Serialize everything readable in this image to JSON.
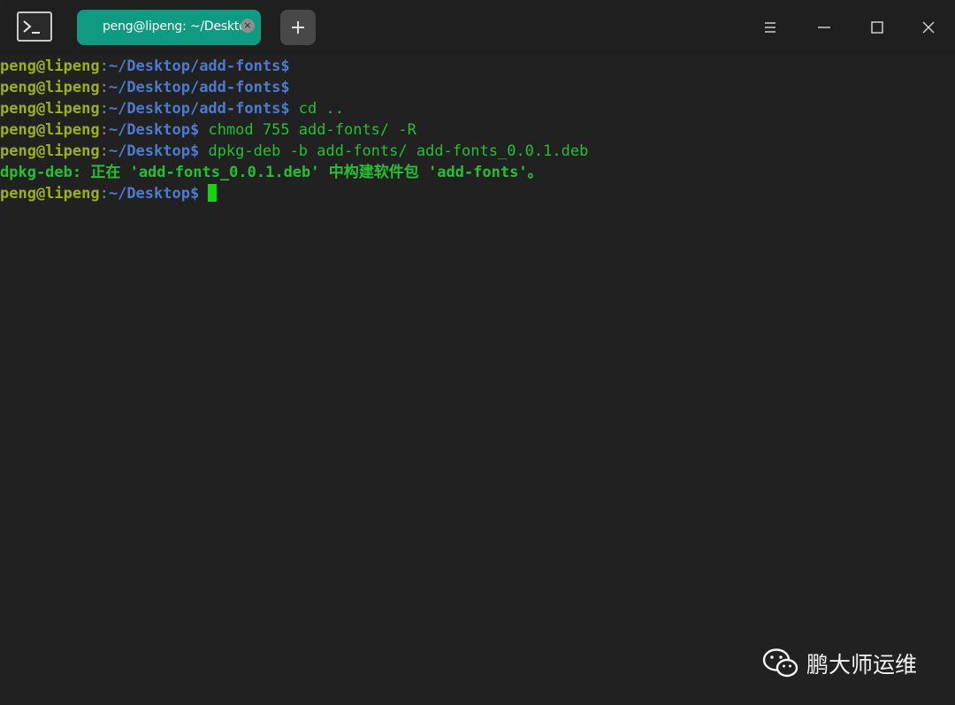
{
  "tab": {
    "title": "peng@lipeng: ~/Desktop",
    "close_glyph": "×"
  },
  "icons": {
    "app": "terminal-icon",
    "new_tab": "plus-icon",
    "menu": "hamburger-menu-icon",
    "minimize": "minimize-icon",
    "maximize": "maximize-icon",
    "close": "close-icon",
    "watermark": "wechat-icon"
  },
  "terminal": {
    "lines": [
      {
        "user": "peng@lipeng",
        "sep": ":",
        "path": "~/Desktop/add-fonts",
        "prompt": "$",
        "command": ""
      },
      {
        "user": "peng@lipeng",
        "sep": ":",
        "path": "~/Desktop/add-fonts",
        "prompt": "$",
        "command": ""
      },
      {
        "user": "peng@lipeng",
        "sep": ":",
        "path": "~/Desktop/add-fonts",
        "prompt": "$",
        "command": " cd .."
      },
      {
        "user": "peng@lipeng",
        "sep": ":",
        "path": "~/Desktop",
        "prompt": "$",
        "command": " chmod 755 add-fonts/ -R"
      },
      {
        "user": "peng@lipeng",
        "sep": ":",
        "path": "~/Desktop",
        "prompt": "$",
        "command": " dpkg-deb -b add-fonts/ add-fonts_0.0.1.deb"
      },
      {
        "output": "dpkg-deb: 正在 'add-fonts_0.0.1.deb' 中构建软件包 'add-fonts'。"
      },
      {
        "user": "peng@lipeng",
        "sep": ":",
        "path": "~/Desktop",
        "prompt": "$",
        "command": " "
      }
    ]
  },
  "watermark": {
    "text": "鹏大师运维"
  },
  "colors": {
    "background": "#212121",
    "tab_active": "#0f9b82",
    "user": "#9cb018",
    "path": "#4b7bd0",
    "command": "#22c132",
    "cursor": "#10d612"
  }
}
